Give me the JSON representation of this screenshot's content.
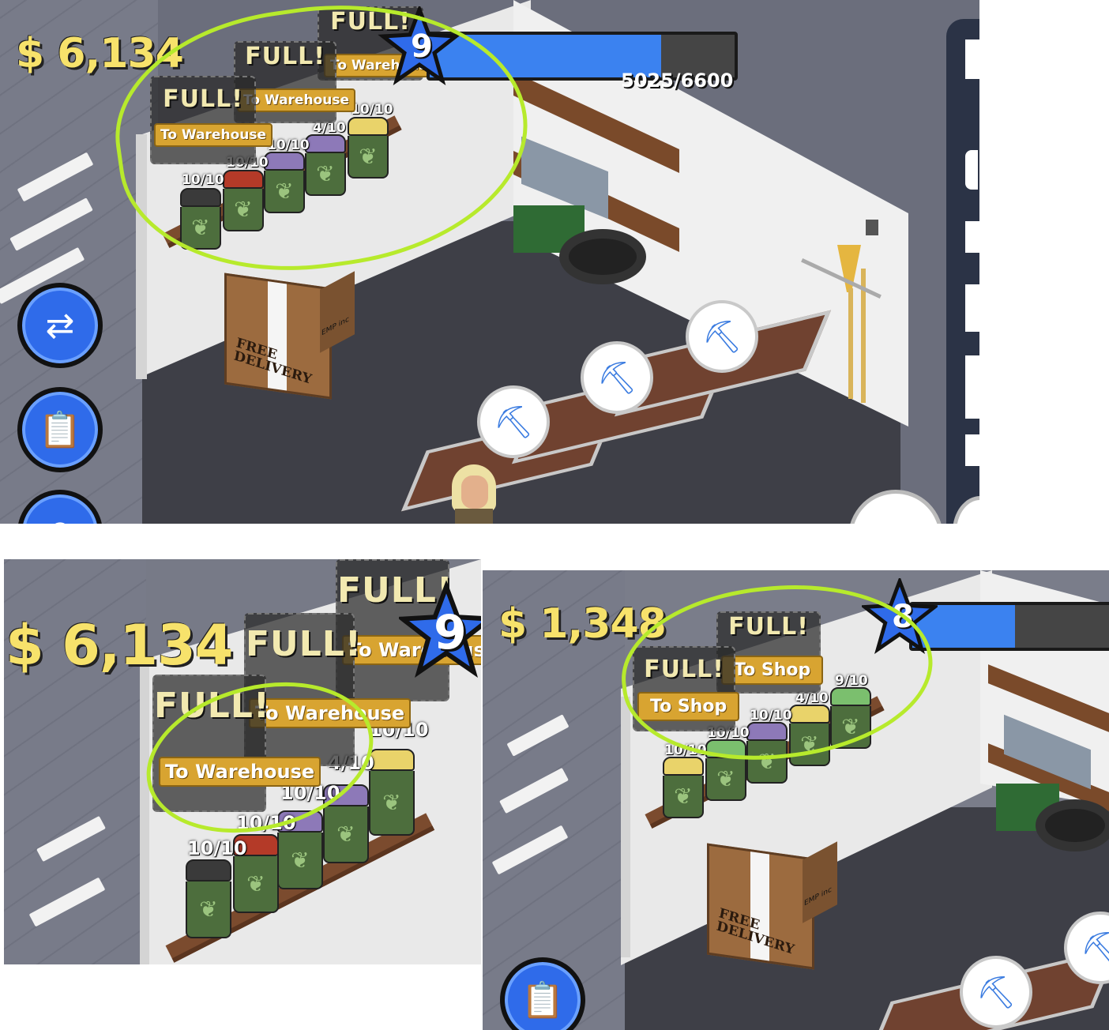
{
  "screens": {
    "top": {
      "money": "$ 6,134",
      "level": "9",
      "xp_text": "5025/6600",
      "xp_fraction": 0.76,
      "bubbles": [
        {
          "full": "FULL!",
          "button": "To Warehouse"
        },
        {
          "full": "FULL!",
          "button": "To Warehouse"
        },
        {
          "full": "FULL!",
          "button": "To Warehouse"
        }
      ],
      "jars": [
        {
          "count": "10/10",
          "lid": "#3a3a3a"
        },
        {
          "count": "10/10",
          "lid": "#b43a28"
        },
        {
          "count": "10/10",
          "lid": "#8d79b8"
        },
        {
          "count": "4/10",
          "lid": "#8d79b8"
        },
        {
          "count": "10/10",
          "lid": "#e9d36a"
        }
      ],
      "box_label": "FREE DELIVERY",
      "box_side": "EMP inc"
    },
    "bottom_left": {
      "money": "$ 6,134",
      "level": "9",
      "bubbles": [
        {
          "full": "FULL!",
          "button": "To Warehouse"
        },
        {
          "full": "FULL!",
          "button": "To Warehouse"
        },
        {
          "full": "FULL!",
          "button": "To Warehouse"
        }
      ],
      "jars": [
        {
          "count": "10/10",
          "lid": "#3a3a3a"
        },
        {
          "count": "10/10",
          "lid": "#b43a28"
        },
        {
          "count": "10/10",
          "lid": "#8d79b8"
        },
        {
          "count": "4/10",
          "lid": "#8d79b8"
        },
        {
          "count": "10/10",
          "lid": "#e9d36a"
        }
      ]
    },
    "bottom_right": {
      "money": "$ 1,348",
      "level": "8",
      "xp_fraction": 0.5,
      "bubbles": [
        {
          "full": "FULL!",
          "button": "To Shop"
        },
        {
          "full": "FULL!",
          "button": "To Shop"
        }
      ],
      "jars": [
        {
          "count": "10/10",
          "lid": "#e9d36a"
        },
        {
          "count": "10/10",
          "lid": "#7bbf6e"
        },
        {
          "count": "10/10",
          "lid": "#8d79b8"
        },
        {
          "count": "4/10",
          "lid": "#e9d36a"
        },
        {
          "count": "9/10",
          "lid": "#7bbf6e"
        }
      ],
      "box_label": "FREE DELIVERY",
      "box_side": "EMP inc"
    }
  },
  "colors": {
    "highlight": "#b7ea2c",
    "money": "#f7e26b",
    "xp_fill": "#3b82f0",
    "button_gold": "#d8a431"
  },
  "icons": [
    "swap-weed-icon",
    "clipboard-icon",
    "location-pin-icon",
    "trowel-icon",
    "star-level-icon",
    "cannabis-leaf-icon"
  ]
}
